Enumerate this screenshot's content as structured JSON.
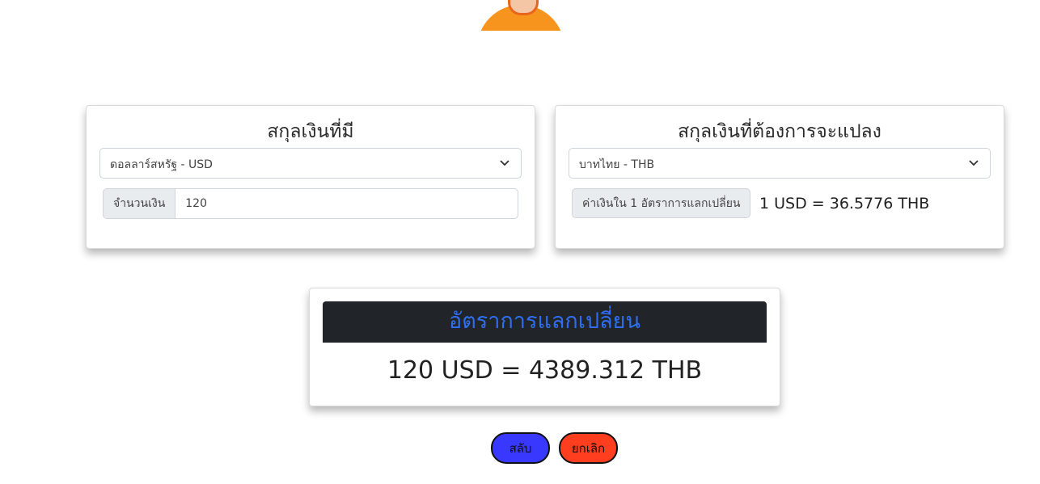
{
  "from_card": {
    "title": "สกุลเงินที่มี",
    "currency_select": {
      "selected": "ดอลลาร์สหรัฐ - USD"
    },
    "amount_label": "จำนวนเงิน",
    "amount_value": "120"
  },
  "to_card": {
    "title": "สกุลเงินที่ต้องการจะแปลง",
    "currency_select": {
      "selected": "บาทไทย - THB"
    },
    "rate_label": "ค่าเงินใน 1 อัตราการแลกเปลี่ยน",
    "rate_value": "1 USD = 36.5776 THB"
  },
  "result_card": {
    "title": "อัตราการแลกเปลี่ยน",
    "result": "120 USD = 4389.312 THB"
  },
  "buttons": {
    "swap_label": "สลับ",
    "cancel_label": "ยกเลิก"
  },
  "colors": {
    "swap_button": "#3838ff",
    "cancel_button": "#ff3d1f",
    "result_header_bg": "#212529",
    "result_header_text": "#2f6ef0",
    "avatar_shirt": "#f7941d"
  },
  "icons": {
    "avatar": "person-avatar-icon",
    "select_chevron": "chevron-down-icon"
  }
}
